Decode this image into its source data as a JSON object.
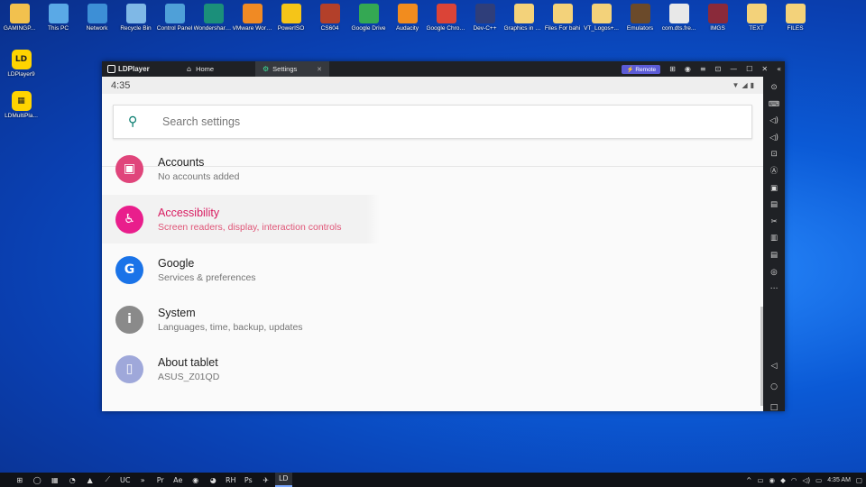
{
  "desktop_icons": [
    {
      "label": "GAMINGP...",
      "icon": "user-folder-icon",
      "color": "#f2c14e"
    },
    {
      "label": "This PC",
      "icon": "pc-icon",
      "color": "#5aa9e6"
    },
    {
      "label": "Network",
      "icon": "network-icon",
      "color": "#3d8fd6"
    },
    {
      "label": "Recycle Bin",
      "icon": "recycle-bin-icon",
      "color": "#7fb8e6"
    },
    {
      "label": "Control Panel",
      "icon": "control-panel-icon",
      "color": "#4fa0d8"
    },
    {
      "label": "Wondershare Filmora X",
      "icon": "filmora-icon",
      "color": "#1b8f7a"
    },
    {
      "label": "VMware Workstati...",
      "icon": "vmware-icon",
      "color": "#f08a24"
    },
    {
      "label": "PowerISO",
      "icon": "poweriso-icon",
      "color": "#f5c518"
    },
    {
      "label": "CS604",
      "icon": "book-icon",
      "color": "#b3402a"
    },
    {
      "label": "Google Drive",
      "icon": "google-drive-icon",
      "color": "#34a853"
    },
    {
      "label": "Audacity",
      "icon": "audacity-icon",
      "color": "#f28c1e"
    },
    {
      "label": "Google Chrome",
      "icon": "chrome-icon",
      "color": "#db4437"
    },
    {
      "label": "Dev-C++",
      "icon": "devcpp-icon",
      "color": "#2f3e7a"
    },
    {
      "label": "Graphics in Dev C++",
      "icon": "folder-icon",
      "color": "#f3d27a"
    },
    {
      "label": "Files For bahi",
      "icon": "folder-icon",
      "color": "#f3d27a"
    },
    {
      "label": "VT_Logos+...",
      "icon": "folder-icon",
      "color": "#f3d27a"
    },
    {
      "label": "Emulators",
      "icon": "folder-icon",
      "color": "#6b4a2a"
    },
    {
      "label": "com.dts.fre...",
      "icon": "file-icon",
      "color": "#e8e8e8"
    },
    {
      "label": "IMGS",
      "icon": "book-icon",
      "color": "#8a2a3a"
    },
    {
      "label": "TEXT",
      "icon": "folder-icon",
      "color": "#f3d27a"
    },
    {
      "label": "FILES",
      "icon": "folder-icon",
      "color": "#f3d27a"
    }
  ],
  "left_icons": [
    {
      "label": "LDPlayer9",
      "glyph": "LD"
    },
    {
      "label": "LDMultiPla...",
      "glyph": "▦"
    }
  ],
  "window": {
    "brand": "LDPlayer",
    "tabs": [
      {
        "label": "Home",
        "icon": "home-icon",
        "glyph": "⌂"
      },
      {
        "label": "Settings",
        "icon": "settings-icon",
        "glyph": "⚙"
      }
    ],
    "remote_label": "Remote",
    "title_glyphs": [
      "⊞",
      "◉",
      "≡",
      "⊡",
      "—",
      "☐",
      "✕",
      "«"
    ]
  },
  "android": {
    "time": "4:35",
    "search_placeholder": "Search settings",
    "items": [
      {
        "title": "Accounts",
        "subtitle": "No accounts added",
        "icon": "accounts-icon",
        "glyph": "▣",
        "color": "#e0457b"
      },
      {
        "title": "Accessibility",
        "subtitle": "Screen readers, display, interaction controls",
        "icon": "accessibility-icon",
        "glyph": "♿",
        "color": "#e91e8c"
      },
      {
        "title": "Google",
        "subtitle": "Services & preferences",
        "icon": "google-icon",
        "glyph": "G",
        "color": "#1a73e8"
      },
      {
        "title": "System",
        "subtitle": "Languages, time, backup, updates",
        "icon": "system-info-icon",
        "glyph": "i",
        "color": "#8a8a8a"
      },
      {
        "title": "About tablet",
        "subtitle": "ASUS_Z01QD",
        "icon": "tablet-icon",
        "glyph": "▯",
        "color": "#9fa8da"
      }
    ]
  },
  "sidebar_glyphs": [
    "⊙",
    "⌨",
    "◁)",
    "◁)",
    "⊡",
    "Ⓐ",
    "▣",
    "▤",
    "✂",
    "▥",
    "▤",
    "◎",
    "⋯"
  ],
  "nav_glyphs": [
    "◁",
    "○",
    "□"
  ],
  "taskbar": {
    "apps": [
      "⊞",
      "◯",
      "▦",
      "◔",
      "▲",
      "⟋",
      "UC",
      "»",
      "Pr",
      "Ae",
      "◉",
      "◕",
      "RH",
      "Ps",
      "✈",
      "LD"
    ],
    "time": "4:35 AM"
  }
}
